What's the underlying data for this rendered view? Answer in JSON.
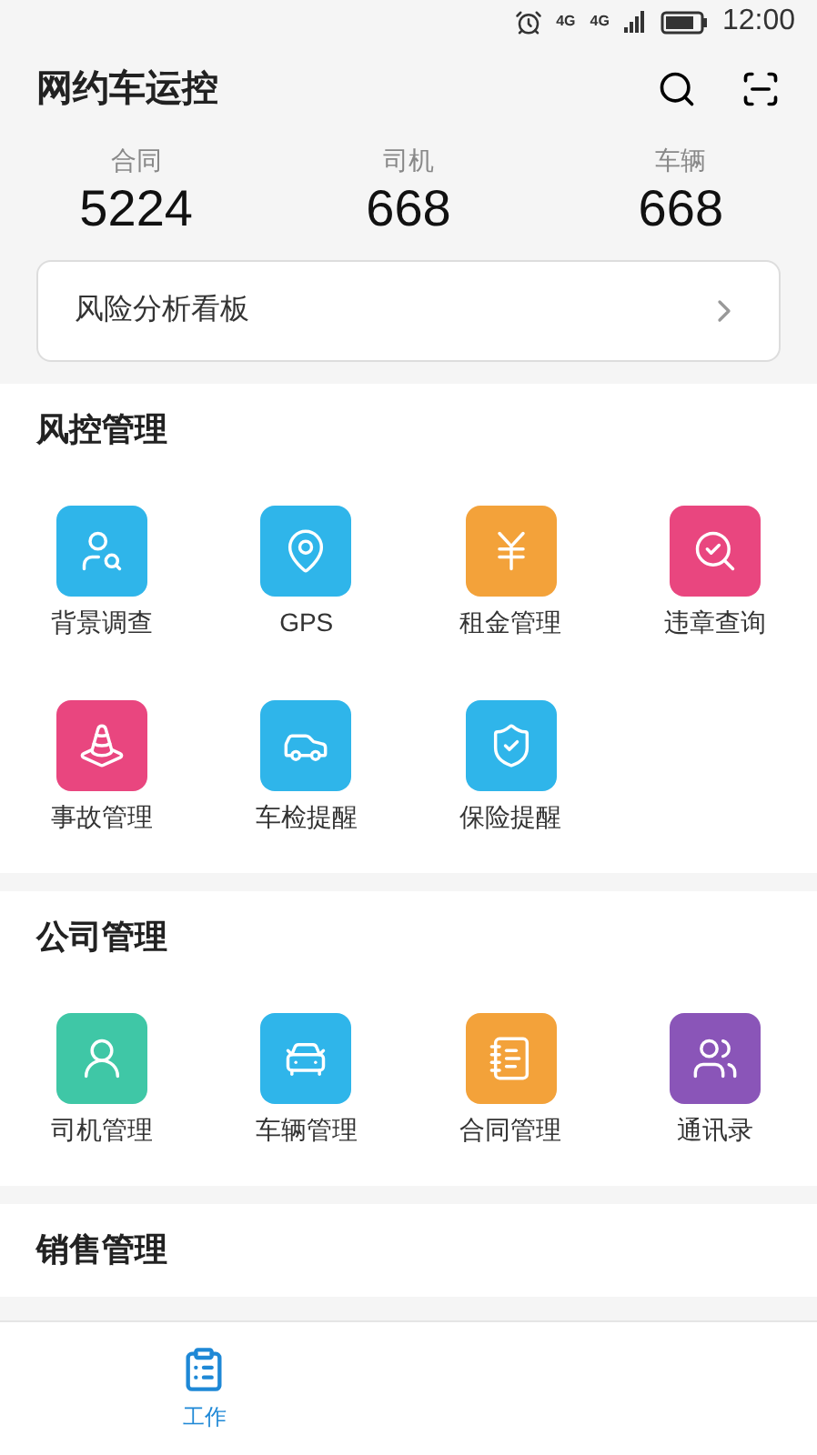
{
  "status_bar": {
    "network_labels": [
      "4G",
      "4G"
    ],
    "time": "12:00"
  },
  "header": {
    "title": "网约车运控"
  },
  "stats": [
    {
      "label": "合同",
      "value": "5224"
    },
    {
      "label": "司机",
      "value": "668"
    },
    {
      "label": "车辆",
      "value": "668"
    }
  ],
  "risk_board": {
    "label": "风险分析看板"
  },
  "sections": [
    {
      "title": "风控管理",
      "items": [
        {
          "label": "背景调查",
          "color": "#2fb5ea"
        },
        {
          "label": "GPS",
          "color": "#2fb5ea"
        },
        {
          "label": "租金管理",
          "color": "#f3a23a"
        },
        {
          "label": "违章查询",
          "color": "#e9467f"
        },
        {
          "label": "事故管理",
          "color": "#e9467f"
        },
        {
          "label": "车检提醒",
          "color": "#2fb5ea"
        },
        {
          "label": "保险提醒",
          "color": "#2fb5ea"
        }
      ]
    },
    {
      "title": "公司管理",
      "items": [
        {
          "label": "司机管理",
          "color": "#3fc7a6"
        },
        {
          "label": "车辆管理",
          "color": "#2fb5ea"
        },
        {
          "label": "合同管理",
          "color": "#f3a23a"
        },
        {
          "label": "通讯录",
          "color": "#8a55b8"
        }
      ]
    },
    {
      "title": "销售管理"
    }
  ],
  "tab_bar": [
    {
      "label": "工作",
      "selected": true
    }
  ]
}
